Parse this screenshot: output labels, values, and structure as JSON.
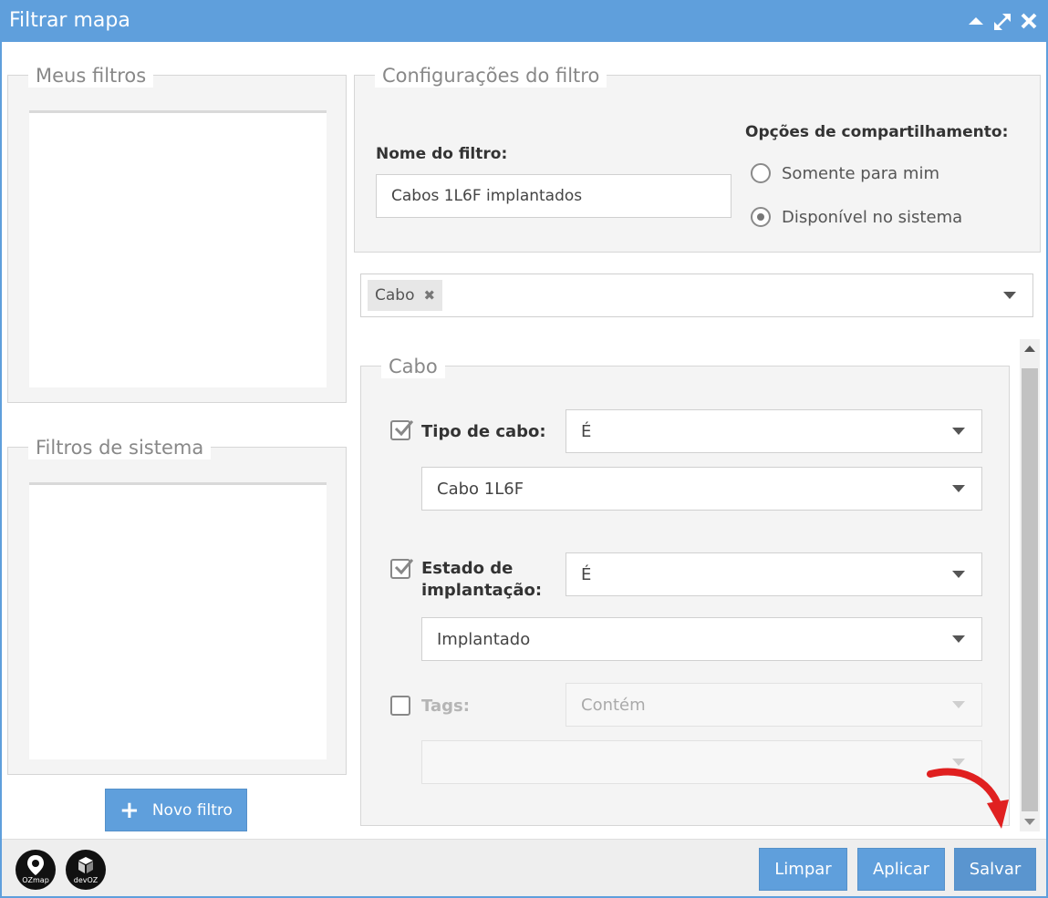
{
  "window": {
    "title": "Filtrar mapa",
    "controls": [
      "collapse-icon",
      "maximize-icon",
      "close-icon"
    ]
  },
  "left": {
    "my_filters_legend": "Meus filtros",
    "system_filters_legend": "Filtros de sistema",
    "new_filter_button": "Novo filtro"
  },
  "config": {
    "legend": "Configurações do filtro",
    "name_label": "Nome do filtro:",
    "name_value": "Cabos 1L6F implantados",
    "sharing_label": "Opções de compartilhamento:",
    "sharing_options": [
      {
        "label": "Somente para mim",
        "checked": false
      },
      {
        "label": "Disponível no sistema",
        "checked": true
      }
    ]
  },
  "layers_select": {
    "selected_chip": "Cabo"
  },
  "cabo_section": {
    "legend": "Cabo",
    "rows": [
      {
        "label": "Tipo de cabo:",
        "checked": true,
        "operator": "É",
        "value": "Cabo 1L6F"
      },
      {
        "label_line1": "Estado de",
        "label_line2": "implantação:",
        "checked": true,
        "operator": "É",
        "value": "Implantado"
      },
      {
        "label": "Tags:",
        "checked": false,
        "operator": "Contém",
        "value": ""
      }
    ]
  },
  "footer": {
    "logos": [
      {
        "name": "ozmap-logo",
        "text": "OZmap"
      },
      {
        "name": "devoz-logo",
        "text": "devOZ"
      }
    ],
    "buttons": {
      "clear": "Limpar",
      "apply": "Aplicar",
      "save": "Salvar"
    }
  },
  "colors": {
    "accent": "#5f9fdc",
    "annotation_arrow": "#e02020"
  }
}
